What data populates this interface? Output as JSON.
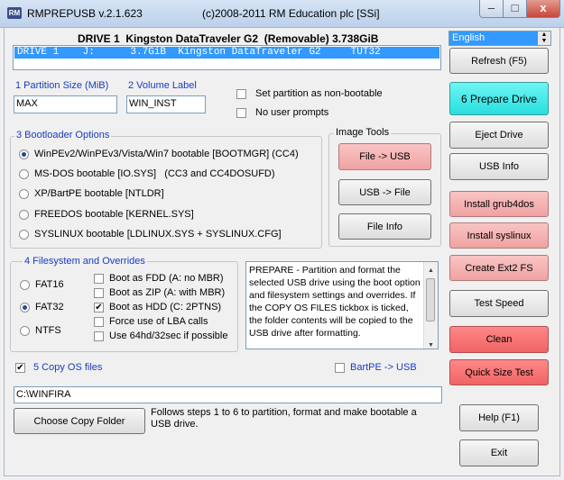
{
  "window": {
    "app_icon": "RM",
    "title": "RMPREPUSB v.2.1.623",
    "subtitle": "(c)2008-2011 RM Education plc [SSi]",
    "controls": {
      "minimize": "–",
      "maximize": "□",
      "close": "x"
    }
  },
  "drive": {
    "header": "DRIVE 1  Kingston DataTraveler G2  (Removable) 3.738GiB",
    "list_row": "DRIVE 1    J:      3.7GiB  Kingston DataTraveler G2     TUT32"
  },
  "language": {
    "selected": "English"
  },
  "partition": {
    "size_label": "1 Partition Size (MiB)",
    "size_value": "MAX",
    "volume_label": "2 Volume Label",
    "volume_value": "WIN_INST",
    "non_bootable": "Set partition as non-bootable",
    "no_prompts": "No user prompts"
  },
  "bootloader": {
    "legend": "3 Bootloader Options",
    "options": [
      "WinPEv2/WinPEv3/Vista/Win7 bootable [BOOTMGR] (CC4)",
      "MS-DOS bootable [IO.SYS]   (CC3 and CC4DOSUFD)",
      "XP/BartPE bootable [NTLDR]",
      "FREEDOS bootable [KERNEL.SYS]",
      "SYSLINUX bootable [LDLINUX.SYS + SYSLINUX.CFG]"
    ],
    "selected_index": 0
  },
  "image_tools": {
    "legend": "Image Tools",
    "file_to_usb": "File -> USB",
    "usb_to_file": "USB -> File",
    "file_info": "File Info"
  },
  "filesystem": {
    "legend": "4 Filesystem and Overrides",
    "fs_options": [
      "FAT16",
      "FAT32",
      "NTFS"
    ],
    "fs_selected": "FAT32",
    "overrides": [
      {
        "label": "Boot as FDD (A: no MBR)",
        "checked": false
      },
      {
        "label": "Boot as ZIP (A: with MBR)",
        "checked": false
      },
      {
        "label": "Boot as HDD (C: 2PTNS)",
        "checked": true
      },
      {
        "label": "Force use of LBA calls",
        "checked": false
      },
      {
        "label": "Use 64hd/32sec if possible",
        "checked": false
      }
    ]
  },
  "memo": {
    "text": "PREPARE - Partition and format the selected USB drive using the boot option and filesystem settings and overrides. If the COPY OS FILES tickbox is ticked, the folder contents will be copied to the USB drive after formatting."
  },
  "copy_os": {
    "label": "5 Copy OS files",
    "checked": true,
    "bartpe_label": "BartPE -> USB",
    "bartpe_checked": false,
    "path": "C:\\WINFIRA",
    "choose_button": "Choose Copy Folder",
    "hint": "Follows steps 1 to 6 to partition, format and make bootable a USB drive."
  },
  "right_buttons": {
    "refresh": "Refresh (F5)",
    "prepare": "6 Prepare Drive",
    "eject": "Eject Drive",
    "usb_info": "USB Info",
    "install_grub4dos": "Install grub4dos",
    "install_syslinux": "Install syslinux",
    "create_ext2": "Create Ext2 FS",
    "test_speed": "Test Speed",
    "clean": "Clean",
    "quick_size_test": "Quick Size Test",
    "help": "Help (F1)",
    "exit": "Exit"
  },
  "colors": {
    "prepare": "#28dede",
    "pink": "#f0a2a2",
    "red": "#f06464",
    "selection": "#3399ff",
    "label_blue": "#1a3bbf"
  }
}
